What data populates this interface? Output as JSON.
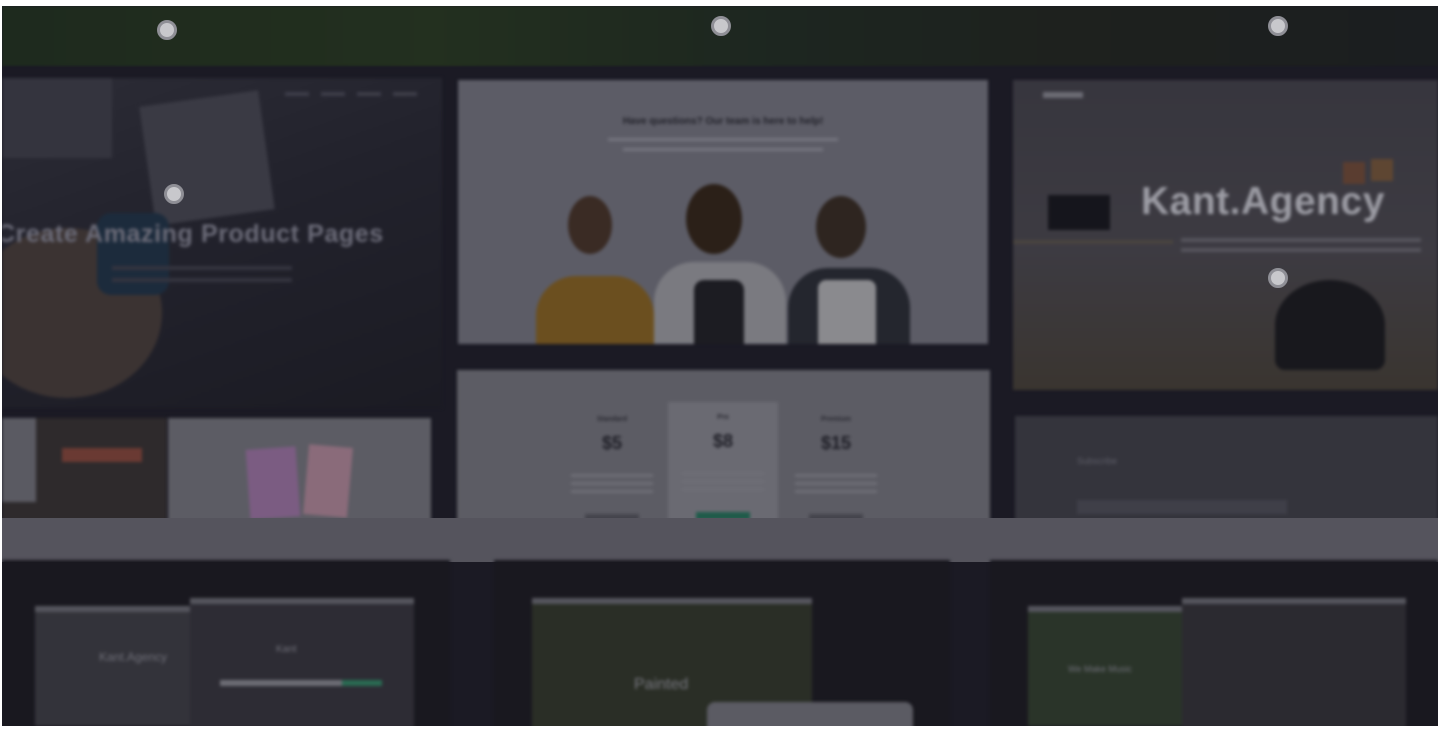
{
  "previews": {
    "product_pages": {
      "headline": "Create Amazing Product Pages"
    },
    "team": {
      "headline": "Have questions? Our team is here to help!"
    },
    "agency": {
      "headline": "Kant.Agency"
    },
    "pricing": {
      "plans": [
        {
          "name": "Standard",
          "price": "$5"
        },
        {
          "name": "Pro",
          "price": "$8"
        },
        {
          "name": "Premium",
          "price": "$15"
        }
      ]
    },
    "subscribe": {
      "title": "Subscribe"
    }
  },
  "theme_cards": [
    {
      "label": "Kant.Agency",
      "screen_label": "Kant"
    },
    {
      "label": "Painted"
    },
    {
      "label": "We Make Music"
    }
  ],
  "colors": {
    "overlay": "#1b1a24",
    "accent_green": "#1f5b4a"
  }
}
